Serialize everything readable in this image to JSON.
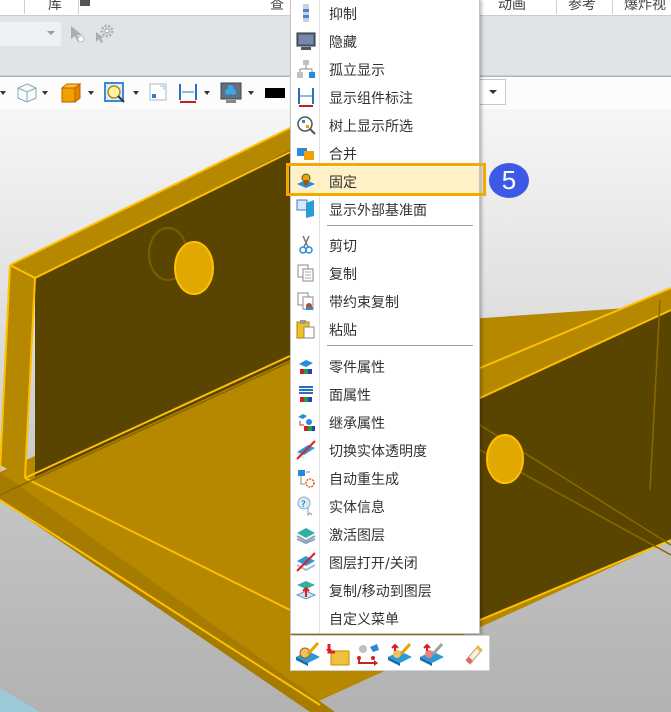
{
  "ribbon": {
    "tabs": [
      {
        "label": "库",
        "name": "tab-library"
      },
      {
        "label": "查",
        "name": "tab-inquire"
      },
      {
        "label": "动画",
        "name": "tab-animation"
      },
      {
        "label": "参考",
        "name": "tab-reference"
      },
      {
        "label": "爆炸视",
        "name": "tab-exploded-view"
      }
    ],
    "filter_combo_value": ""
  },
  "view_toolbar": {
    "icons": [
      "wireframe-cube-icon",
      "shaded-cube-icon",
      "zoom-fit-icon",
      "view-frame-icon",
      "dimension-icon",
      "display-settings-icon",
      "color-swatch-icon"
    ],
    "combo_value": ""
  },
  "context_menu": {
    "items": [
      {
        "label": "抑制",
        "icon": "suppress-icon"
      },
      {
        "label": "隐藏",
        "icon": "hide-icon"
      },
      {
        "label": "孤立显示",
        "icon": "isolate-icon"
      },
      {
        "label": "显示组件标注",
        "icon": "component-dimension-icon"
      },
      {
        "label": "树上显示所选",
        "icon": "show-in-tree-icon"
      },
      {
        "label": "合并",
        "icon": "merge-icon"
      },
      {
        "label": "固定",
        "icon": "fix-icon",
        "highlighted": true
      },
      {
        "label": "显示外部基准面",
        "icon": "external-datum-icon"
      },
      {
        "label": "剪切",
        "icon": "cut-icon"
      },
      {
        "label": "复制",
        "icon": "copy-icon"
      },
      {
        "label": "带约束复制",
        "icon": "copy-with-constraints-icon"
      },
      {
        "label": "粘贴",
        "icon": "paste-icon"
      },
      {
        "label": "零件属性",
        "icon": "part-properties-icon"
      },
      {
        "label": "面属性",
        "icon": "face-properties-icon"
      },
      {
        "label": "继承属性",
        "icon": "inherit-properties-icon"
      },
      {
        "label": "切换实体透明度",
        "icon": "toggle-transparency-icon"
      },
      {
        "label": "自动重生成",
        "icon": "auto-regenerate-icon"
      },
      {
        "label": "实体信息",
        "icon": "entity-info-icon"
      },
      {
        "label": "激活图层",
        "icon": "activate-layer-icon"
      },
      {
        "label": "图层打开/关闭",
        "icon": "layer-toggle-icon"
      },
      {
        "label": "复制/移动到图层",
        "icon": "copy-move-to-layer-icon"
      },
      {
        "label": "自定义菜单",
        "icon": ""
      }
    ],
    "bottom_bar_icons": [
      "edit-part-icon",
      "open-folder-icon",
      "move-component-icon",
      "edit-component-icon",
      "redefine-icon",
      "eraser-icon"
    ]
  },
  "annotation": {
    "step_number": "5",
    "highlight_color": "#f5a800",
    "badge_color": "#3d5ae6"
  },
  "model": {
    "face_color_dark": "#5a4500",
    "face_color_mid": "#b58800",
    "edge_color": "#ffc000"
  }
}
